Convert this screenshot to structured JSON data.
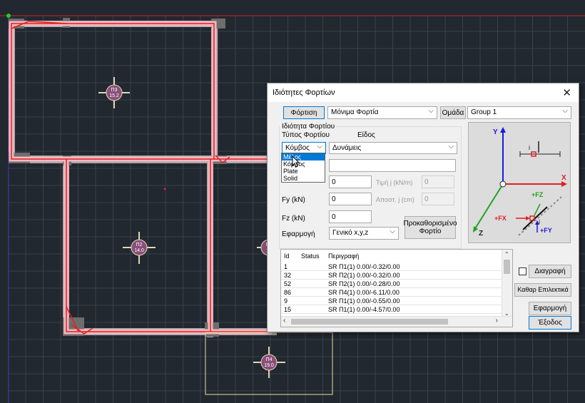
{
  "drawing": {
    "slabs": [
      {
        "name": "Π3",
        "value": "15.2"
      },
      {
        "name": "Π2",
        "value": "14.0"
      },
      {
        "name": "Π4",
        "value": "19.0"
      },
      {
        "name": "Π1",
        "value": "14"
      }
    ]
  },
  "dialog": {
    "title": "Ιδιότητες Φορτίων",
    "close": "✕",
    "loading_button": "Φόρτιση",
    "loading_value": "Μόνιμα Φορτία",
    "group_button": "Ομάδα",
    "group_value": "Group 1",
    "section_label": "Ιδιότητα Φορτίου",
    "load_type_label": "Τύπος Φορτίου",
    "kind_label": "Είδος",
    "load_type_value": "Κόμβος",
    "kind_value": "Δυνάμεις",
    "load_type_options": [
      "Μέλος",
      "Κόμβος",
      "Plate",
      "Solid"
    ],
    "description_value": "",
    "fx_value": "0",
    "fy_label": "Fy (kN)",
    "fy_value": "0",
    "fz_label": "Fz (kN)",
    "fz_value": "0",
    "value_j_label": "Τιμή j (kN/m)",
    "value_j": "0",
    "dist_j_label": "Αποστ. j (cm)",
    "dist_j": "0",
    "apply_label": "Εφαρμογή",
    "apply_value": "Γενικό x,y,z",
    "predefined_button": "Προκαθορισμένο Φορτίο",
    "diagram_labels": {
      "y": "Y",
      "x": "X",
      "z": "Z",
      "fz": "+FZ",
      "fx": "+FX",
      "fy": "+FY",
      "i": "i"
    },
    "table": {
      "headers": [
        "Id",
        "Status",
        "Περιγραφή"
      ],
      "rows": [
        {
          "id": "1",
          "status": "",
          "desc": "SR Π1(1) 0.00/-0.32/0.00"
        },
        {
          "id": "32",
          "status": "",
          "desc": "SR Π2(1) 0.00/-0.32/0.00"
        },
        {
          "id": "52",
          "status": "",
          "desc": "SR Π2(1) 0.00/-0.28/0.00"
        },
        {
          "id": "86",
          "status": "",
          "desc": "SR Π4(1) 0.00/-6.11/0.00"
        },
        {
          "id": "9",
          "status": "",
          "desc": "SR Π1(1) 0.00/-0.55/0.00"
        },
        {
          "id": "15",
          "status": "",
          "desc": "SR Π1(1) 0.00/-4.57/0.00"
        }
      ]
    },
    "delete_label": "Διαγραφή",
    "delete_checked": false,
    "clear_selected_button": "Καθαρ Επιλεκτικά",
    "apply_button": "Εφαρμογή",
    "exit_button": "Έξοδος"
  }
}
